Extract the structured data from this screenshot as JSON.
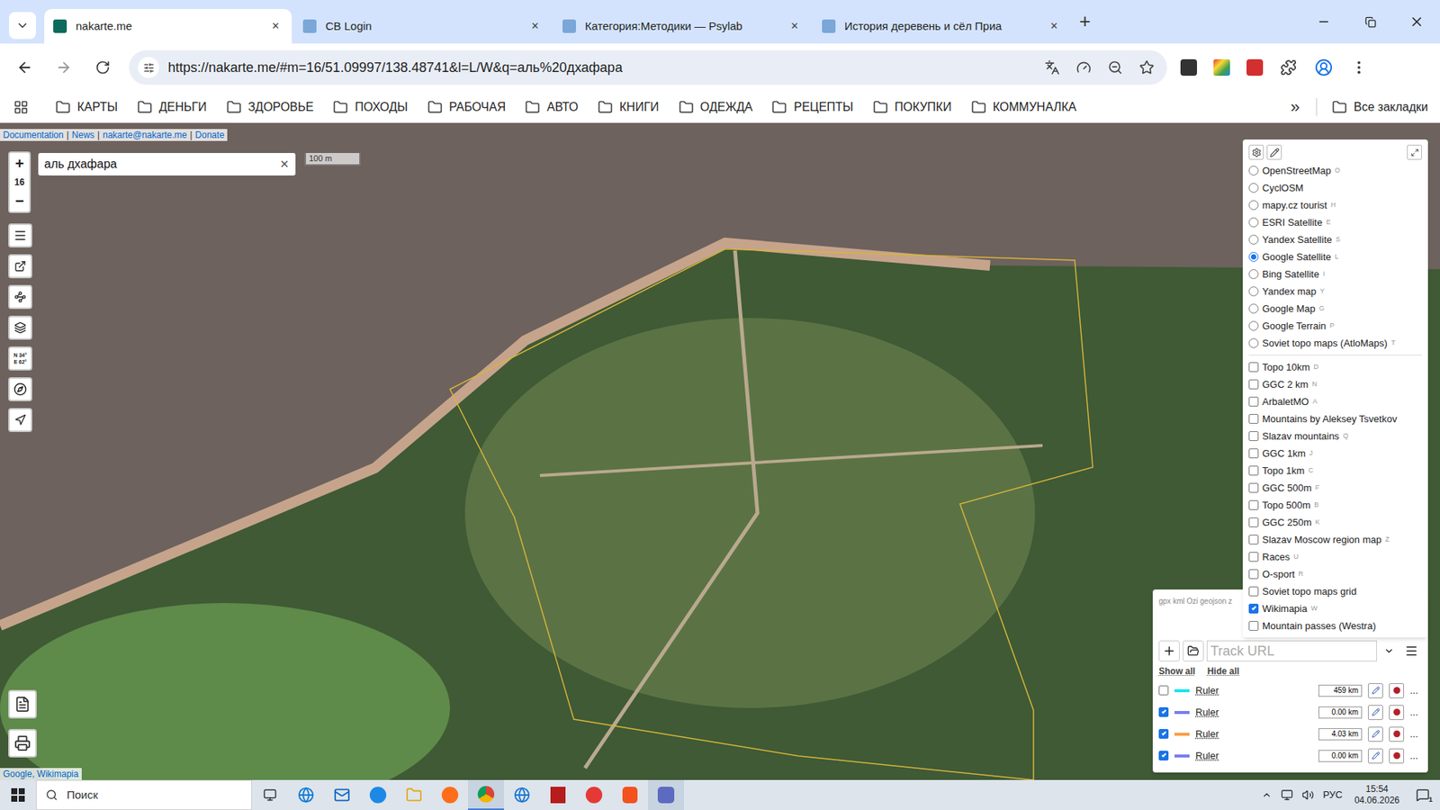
{
  "browser": {
    "tabs": [
      {
        "title": "nakarte.me",
        "selected": true
      },
      {
        "title": "CB Login",
        "selected": false
      },
      {
        "title": "Категория:Методики — Psylab",
        "selected": false
      },
      {
        "title": "История деревень и сёл Приа",
        "selected": false
      }
    ],
    "tab_close": "✕",
    "new_tab": "+",
    "url": "https://nakarte.me/#m=16/51.09997/138.48741&l=L/W&q=аль%20дхафара",
    "bookmarks": [
      "КАРТЫ",
      "ДЕНЬГИ",
      "ЗДОРОВЬЕ",
      "ПОХОДЫ",
      "РАБОЧАЯ",
      "АВТО",
      "КНИГИ",
      "ОДЕЖДА",
      "РЕЦЕПТЫ",
      "ПОКУПКИ",
      "КОММУНАЛКА"
    ],
    "bookmarks_more": "»",
    "all_bookmarks": "Все закладки"
  },
  "map": {
    "links": [
      "Documentation",
      "News",
      "nakarte@nakarte.me",
      "Donate"
    ],
    "link_separator": "|",
    "zoom": {
      "in": "+",
      "level": "16",
      "out": "−"
    },
    "search": {
      "value": "аль дхафара",
      "clear": "✕"
    },
    "scale": "100 m",
    "coordinates": [
      "N 34°",
      "E 62°"
    ],
    "attribution": "Google, Wikimapia"
  },
  "layers": {
    "base": [
      {
        "name": "OpenStreetMap",
        "key": "O",
        "selected": false
      },
      {
        "name": "CyclOSM",
        "key": "",
        "selected": false
      },
      {
        "name": "mapy.cz tourist",
        "key": "H",
        "selected": false
      },
      {
        "name": "ESRI Satellite",
        "key": "E",
        "selected": false
      },
      {
        "name": "Yandex Satellite",
        "key": "S",
        "selected": false
      },
      {
        "name": "Google Satellite",
        "key": "L",
        "selected": true
      },
      {
        "name": "Bing Satellite",
        "key": "I",
        "selected": false
      },
      {
        "name": "Yandex map",
        "key": "Y",
        "selected": false
      },
      {
        "name": "Google Map",
        "key": "G",
        "selected": false
      },
      {
        "name": "Google Terrain",
        "key": "P",
        "selected": false
      },
      {
        "name": "Soviet topo maps (AtloMaps)",
        "key": "T",
        "selected": false
      }
    ],
    "overlays": [
      {
        "name": "Topo 10km",
        "key": "D",
        "checked": false
      },
      {
        "name": "GGC 2 km",
        "key": "N",
        "checked": false
      },
      {
        "name": "ArbaletMO",
        "key": "A",
        "checked": false
      },
      {
        "name": "Mountains by Aleksey Tsvetkov",
        "key": "",
        "checked": false
      },
      {
        "name": "Slazav mountains",
        "key": "Q",
        "checked": false
      },
      {
        "name": "GGC 1km",
        "key": "J",
        "checked": false
      },
      {
        "name": "Topo 1km",
        "key": "C",
        "checked": false
      },
      {
        "name": "GGC 500m",
        "key": "F",
        "checked": false
      },
      {
        "name": "Topo 500m",
        "key": "B",
        "checked": false
      },
      {
        "name": "GGC 250m",
        "key": "K",
        "checked": false
      },
      {
        "name": "Slazav Moscow region map",
        "key": "Z",
        "checked": false
      },
      {
        "name": "Races",
        "key": "U",
        "checked": false
      },
      {
        "name": "O-sport",
        "key": "R",
        "checked": false
      },
      {
        "name": "Soviet topo maps grid",
        "key": "",
        "checked": false
      },
      {
        "name": "Wikimapia",
        "key": "W",
        "checked": true
      },
      {
        "name": "Mountain passes (Westra)",
        "key": "",
        "checked": false
      }
    ]
  },
  "tracks": {
    "formats": "gpx kml Ozi geojson z",
    "url_placeholder": "Track URL",
    "show_all": "Show all",
    "hide_all": "Hide all",
    "more": "...",
    "rows": [
      {
        "name": "Ruler",
        "checked": false,
        "color": "#19e6f0",
        "distance": "459 km"
      },
      {
        "name": "Ruler",
        "checked": true,
        "color": "#7b7bf0",
        "distance": "0.00 km"
      },
      {
        "name": "Ruler",
        "checked": true,
        "color": "#f7a04a",
        "distance": "4.03 km"
      },
      {
        "name": "Ruler",
        "checked": true,
        "color": "#7b7bf0",
        "distance": "0.00 km"
      }
    ]
  },
  "taskbar": {
    "search": "Поиск",
    "language": "РУС",
    "time": "15:54",
    "date": "04.06.2026",
    "notifications": "1"
  }
}
